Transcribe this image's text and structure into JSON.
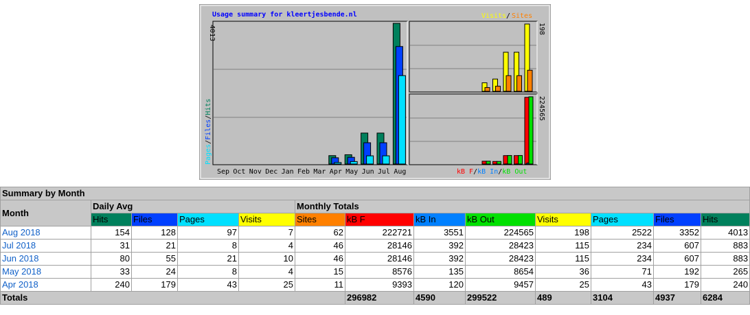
{
  "chart_data": {
    "type": "bar",
    "title": "Usage summary for kleertjesbende.nl",
    "months": [
      "Sep",
      "Oct",
      "Nov",
      "Dec",
      "Jan",
      "Feb",
      "Mar",
      "Apr",
      "May",
      "Jun",
      "Jul",
      "Aug"
    ],
    "left_panel": {
      "label_max": "4013",
      "ymax": 4013,
      "legend": [
        "Pages",
        "Files",
        "Hits"
      ],
      "series": [
        {
          "name": "Hits",
          "color": "#00805c",
          "values": [
            0,
            0,
            0,
            0,
            0,
            0,
            0,
            240,
            265,
            883,
            883,
            4013
          ]
        },
        {
          "name": "Files",
          "color": "#0040ff",
          "values": [
            0,
            0,
            0,
            0,
            0,
            0,
            0,
            179,
            192,
            607,
            607,
            3352
          ]
        },
        {
          "name": "Pages",
          "color": "#00e0ff",
          "values": [
            0,
            0,
            0,
            0,
            0,
            0,
            0,
            43,
            71,
            234,
            234,
            2522
          ]
        }
      ]
    },
    "top_right_panel": {
      "label_max": "198",
      "ymax": 198,
      "legend": [
        "Visits",
        "Sites"
      ],
      "series": [
        {
          "name": "Visits",
          "color": "#ffff00",
          "values": [
            25,
            36,
            115,
            115,
            198
          ]
        },
        {
          "name": "Sites",
          "color": "#ff8000",
          "values": [
            11,
            15,
            46,
            46,
            62
          ]
        }
      ]
    },
    "bottom_right_panel": {
      "label_max": "224565",
      "ymax": 224565,
      "legend": [
        "kB F",
        "kB In",
        "kB Out"
      ],
      "series": [
        {
          "name": "kB F",
          "color": "#ff0000",
          "values": [
            9393,
            8576,
            28146,
            28146,
            222721
          ]
        },
        {
          "name": "kB In",
          "color": "#0080ff",
          "values": [
            120,
            135,
            392,
            392,
            3551
          ]
        },
        {
          "name": "kB Out",
          "color": "#00e000",
          "values": [
            9457,
            8654,
            28423,
            28423,
            224565
          ]
        }
      ]
    }
  },
  "table": {
    "caption": "Summary by Month",
    "month_header": "Month",
    "daily_avg_header": "Daily Avg",
    "monthly_totals_header": "Monthly Totals",
    "columns": [
      "Hits",
      "Files",
      "Pages",
      "Visits",
      "Sites",
      "kB F",
      "kB In",
      "kB Out",
      "Visits",
      "Pages",
      "Files",
      "Hits"
    ],
    "rows": [
      {
        "month": "Aug 2018",
        "cells": [
          "154",
          "128",
          "97",
          "7",
          "62",
          "222721",
          "3551",
          "224565",
          "198",
          "2522",
          "3352",
          "4013"
        ]
      },
      {
        "month": "Jul 2018",
        "cells": [
          "31",
          "21",
          "8",
          "4",
          "46",
          "28146",
          "392",
          "28423",
          "115",
          "234",
          "607",
          "883"
        ]
      },
      {
        "month": "Jun 2018",
        "cells": [
          "80",
          "55",
          "21",
          "10",
          "46",
          "28146",
          "392",
          "28423",
          "115",
          "234",
          "607",
          "883"
        ]
      },
      {
        "month": "May 2018",
        "cells": [
          "33",
          "24",
          "8",
          "4",
          "15",
          "8576",
          "135",
          "8654",
          "36",
          "71",
          "192",
          "265"
        ]
      },
      {
        "month": "Apr 2018",
        "cells": [
          "240",
          "179",
          "43",
          "25",
          "11",
          "9393",
          "120",
          "9457",
          "25",
          "43",
          "179",
          "240"
        ]
      }
    ],
    "totals_label": "Totals",
    "totals": [
      "296982",
      "4590",
      "299522",
      "489",
      "3104",
      "4937",
      "6284"
    ]
  },
  "colors": {
    "hits": "#00805c",
    "files": "#0040ff",
    "pages": "#00e0ff",
    "visits": "#ffff00",
    "sites": "#ff8000",
    "kbf": "#ff0000",
    "kbin": "#0080ff",
    "kbout": "#00e000"
  }
}
